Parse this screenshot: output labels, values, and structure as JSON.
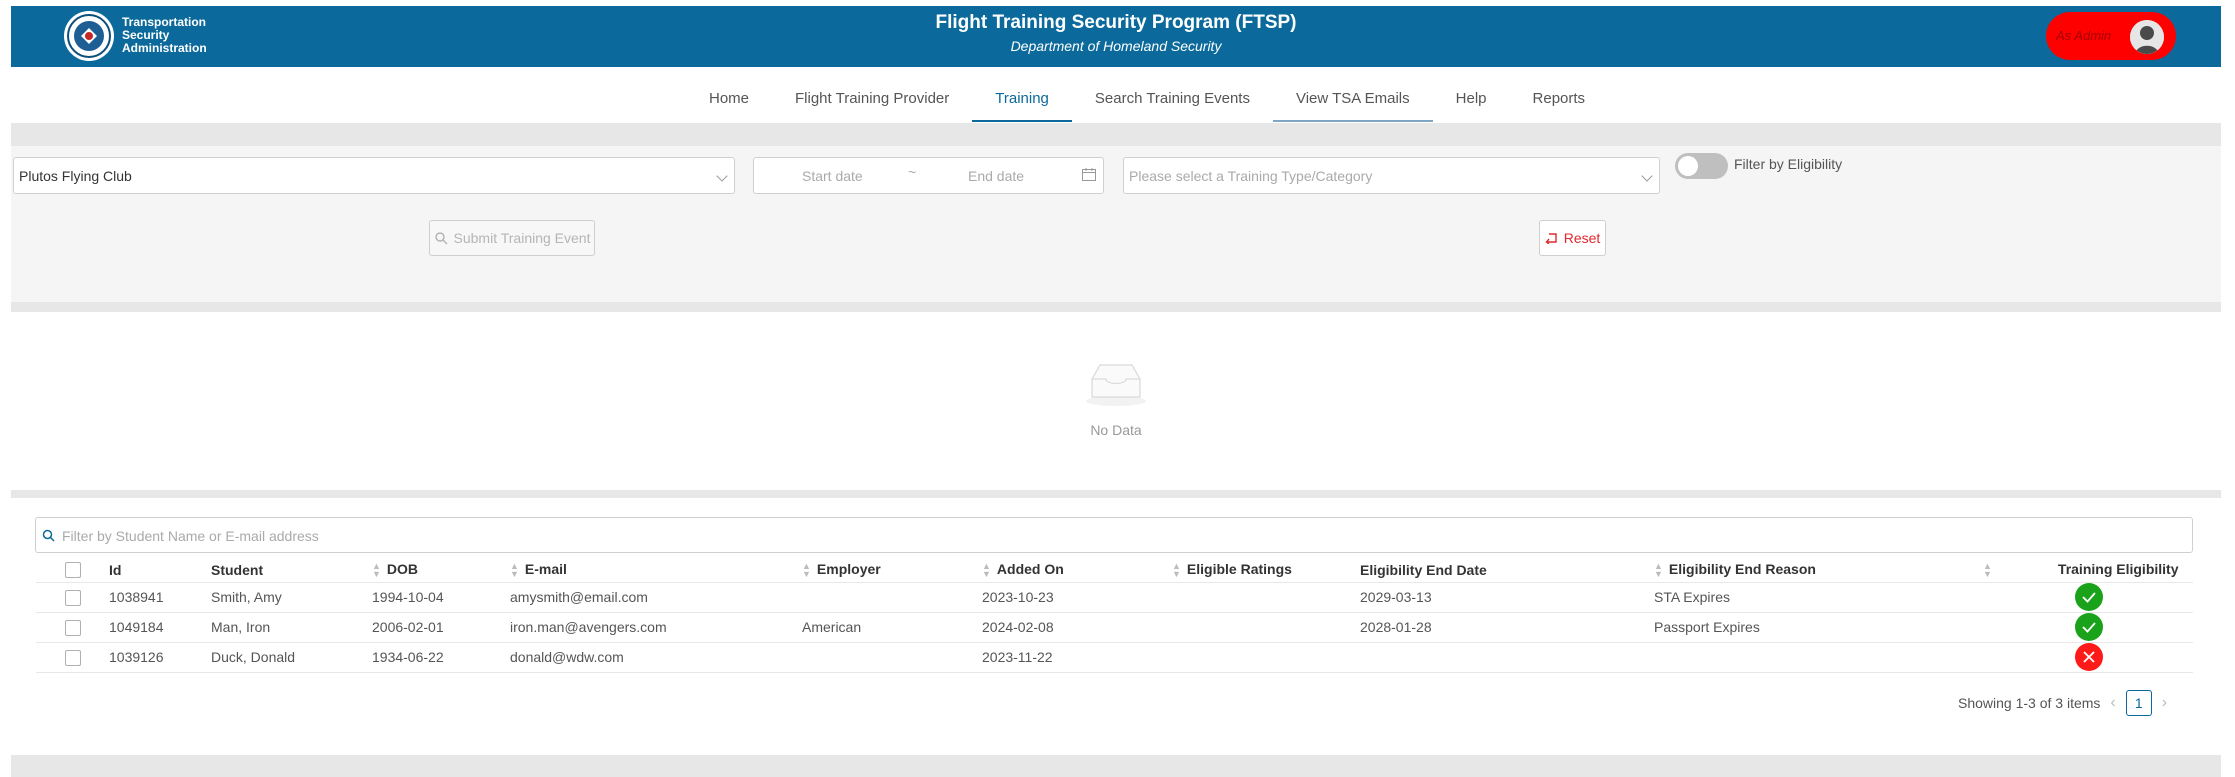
{
  "header": {
    "agency_lines": [
      "Transportation",
      "Security",
      "Administration"
    ],
    "title": "Flight Training Security Program (FTSP)",
    "subtitle": "Department of Homeland Security",
    "user_label": "As Admin",
    "banner_color": "#0b6a9b",
    "user_pill_color": "#ff0000"
  },
  "nav": {
    "items": [
      {
        "label": "Home"
      },
      {
        "label": "Flight Training Provider"
      },
      {
        "label": "Training"
      },
      {
        "label": "Search Training Events"
      },
      {
        "label": "View TSA Emails"
      },
      {
        "label": "Help"
      },
      {
        "label": "Reports"
      }
    ],
    "active": "Training"
  },
  "filters": {
    "provider_value": "Plutos Flying Club",
    "start_date_placeholder": "Start date",
    "date_separator": "~",
    "end_date_placeholder": "End date",
    "training_type_placeholder": "Please select a Training Type/Category",
    "eligibility_toggle_label": "Filter by Eligibility",
    "submit_label": "Submit Training Event",
    "reset_label": "Reset"
  },
  "empty_state": {
    "text": "No Data"
  },
  "student_table": {
    "search_placeholder": "Filter by Student Name or E-mail address",
    "columns": [
      "Id",
      "Student",
      "DOB",
      "E-mail",
      "Employer",
      "Added On",
      "Eligible Ratings",
      "Eligibility End Date",
      "Eligibility End Reason",
      "Training Eligibility"
    ],
    "rows": [
      {
        "id": "1038941",
        "student": "Smith, Amy",
        "dob": "1994-10-04",
        "email": "amysmith@email.com",
        "employer": "",
        "added_on": "2023-10-23",
        "ratings": "",
        "end_date": "2029-03-13",
        "end_reason": "STA Expires",
        "eligible": true
      },
      {
        "id": "1049184",
        "student": "Man, Iron",
        "dob": "2006-02-01",
        "email": "iron.man@avengers.com",
        "employer": "American",
        "added_on": "2024-02-08",
        "ratings": "",
        "end_date": "2028-01-28",
        "end_reason": "Passport Expires",
        "eligible": true
      },
      {
        "id": "1039126",
        "student": "Duck, Donald",
        "dob": "1934-06-22",
        "email": "donald@wdw.com",
        "employer": "",
        "added_on": "2023-11-22",
        "ratings": "",
        "end_date": "",
        "end_reason": "",
        "eligible": false
      }
    ],
    "pagination": {
      "summary": "Showing 1-3 of 3 items",
      "current_page": "1"
    }
  }
}
